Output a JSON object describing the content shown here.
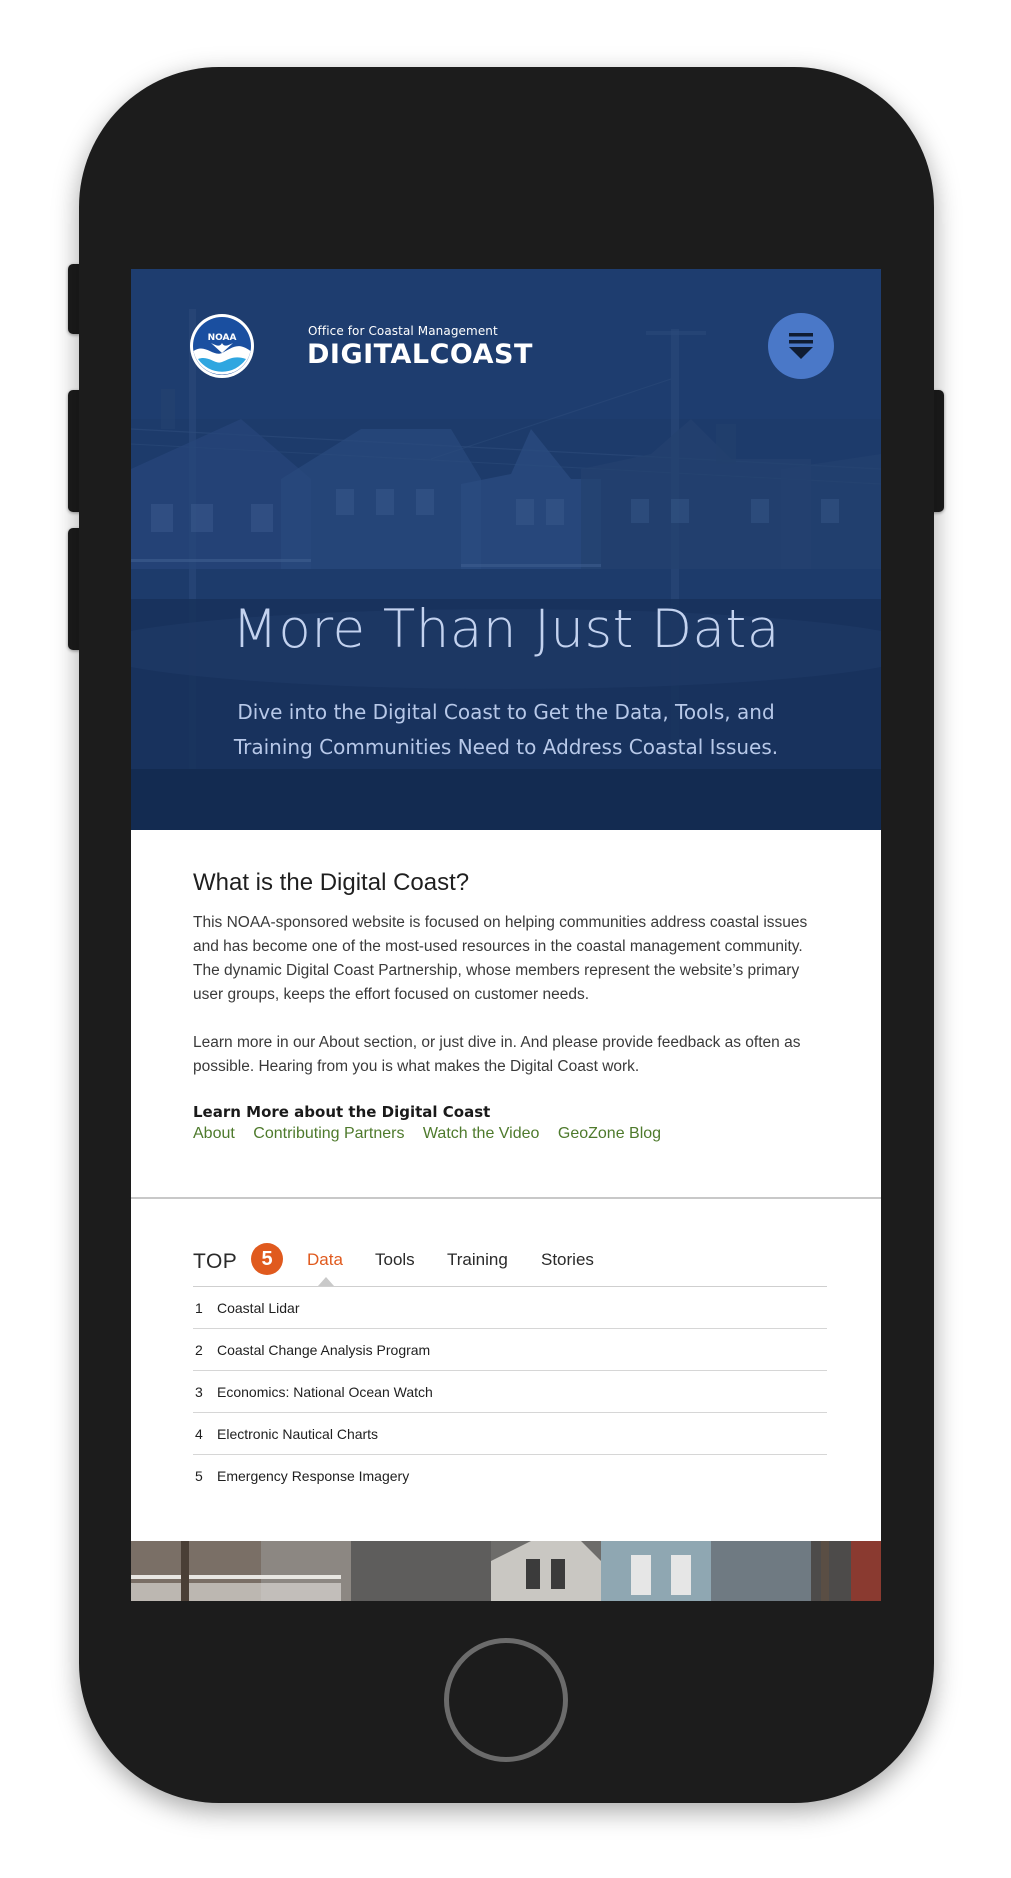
{
  "header": {
    "logo_text": "NOAA",
    "office": "Office for Coastal Management",
    "title": "DIGITALCOAST"
  },
  "hero": {
    "title": "More Than Just Data",
    "subtitle": "Dive into the Digital Coast to Get the Data, Tools, and Training Communities Need to Address Coastal Issues."
  },
  "about": {
    "heading": "What is the Digital Coast?",
    "paragraph1": "This NOAA-sponsored website is focused on helping communities address coastal issues and has become one of the most-used resources in the coastal management community. The dynamic Digital Coast Partnership, whose members represent the website’s primary user groups, keeps the effort focused on customer needs.",
    "paragraph2": "Learn more in our About section, or just dive in. And please provide feedback as often as possible. Hearing from you is what makes the Digital Coast work.",
    "learn_more_title": "Learn More about the Digital Coast",
    "links": [
      "About",
      "Contributing Partners",
      "Watch the Video",
      "GeoZone Blog"
    ]
  },
  "top5": {
    "label": "TOP",
    "count": "5",
    "tabs": [
      "Data",
      "Tools",
      "Training",
      "Stories"
    ],
    "active_tab": "Data",
    "items": [
      {
        "num": "1",
        "name": "Coastal Lidar"
      },
      {
        "num": "2",
        "name": "Coastal Change Analysis Program"
      },
      {
        "num": "3",
        "name": "Economics: National Ocean Watch"
      },
      {
        "num": "4",
        "name": "Electronic Nautical Charts"
      },
      {
        "num": "5",
        "name": "Emergency Response Imagery"
      }
    ]
  },
  "colors": {
    "hero_bg": "#1e3d6e",
    "menu_button": "#4a78c8",
    "accent_orange": "#e05a1e",
    "link_green": "#4e7a2c",
    "phone_body": "#1c1c1c"
  },
  "icons": {
    "logo": "noaa-logo",
    "menu": "menu-dropdown-icon",
    "home": "home-button"
  }
}
